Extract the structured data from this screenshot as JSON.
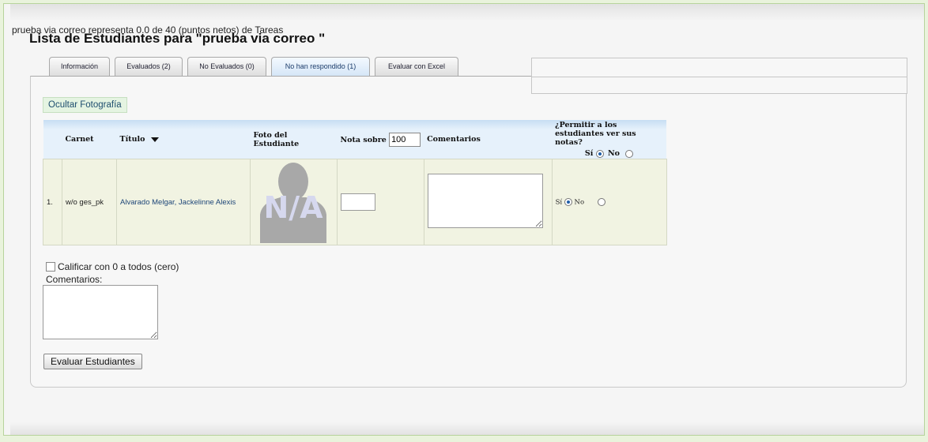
{
  "page": {
    "title": "Lista de Estudiantes para \"prueba via correo \""
  },
  "tabs": [
    {
      "label": "Información"
    },
    {
      "label": "Evaluados (2)"
    },
    {
      "label": "No Evaluados (0)"
    },
    {
      "label": "No han respondido (1)"
    },
    {
      "label": "Evaluar con Excel"
    }
  ],
  "info": {
    "text": "prueba via correo representa 0.0 de 40 (puntos netos) de Tareas"
  },
  "toggle_photo_label": "Ocultar Fotografía",
  "table": {
    "headers": {
      "carnet": "Carnet",
      "titulo": "Título",
      "foto": "Foto del Estudiante",
      "nota": "Nota sobre",
      "nota_value": "100",
      "comentarios": "Comentarios",
      "permitir": "¿Permitir a los estudiantes ver sus notas?",
      "si": "Sí",
      "no": "No"
    },
    "rows": [
      {
        "index": "1.",
        "carnet": "w/o ges_pk",
        "nombre": "Alvarado Melgar, Jackelinne Alexis",
        "photo_text": "N/A",
        "si": "Sí",
        "no": "No"
      }
    ]
  },
  "bottom": {
    "zero_label": "Calificar con 0 a todos (cero)",
    "comments_label": "Comentarios:",
    "submit_label": "Evaluar Estudiantes"
  },
  "colors": {
    "accent": "#1e4678",
    "header_bg": "#e6f1fb",
    "row_bg": "#f1f3e2"
  }
}
